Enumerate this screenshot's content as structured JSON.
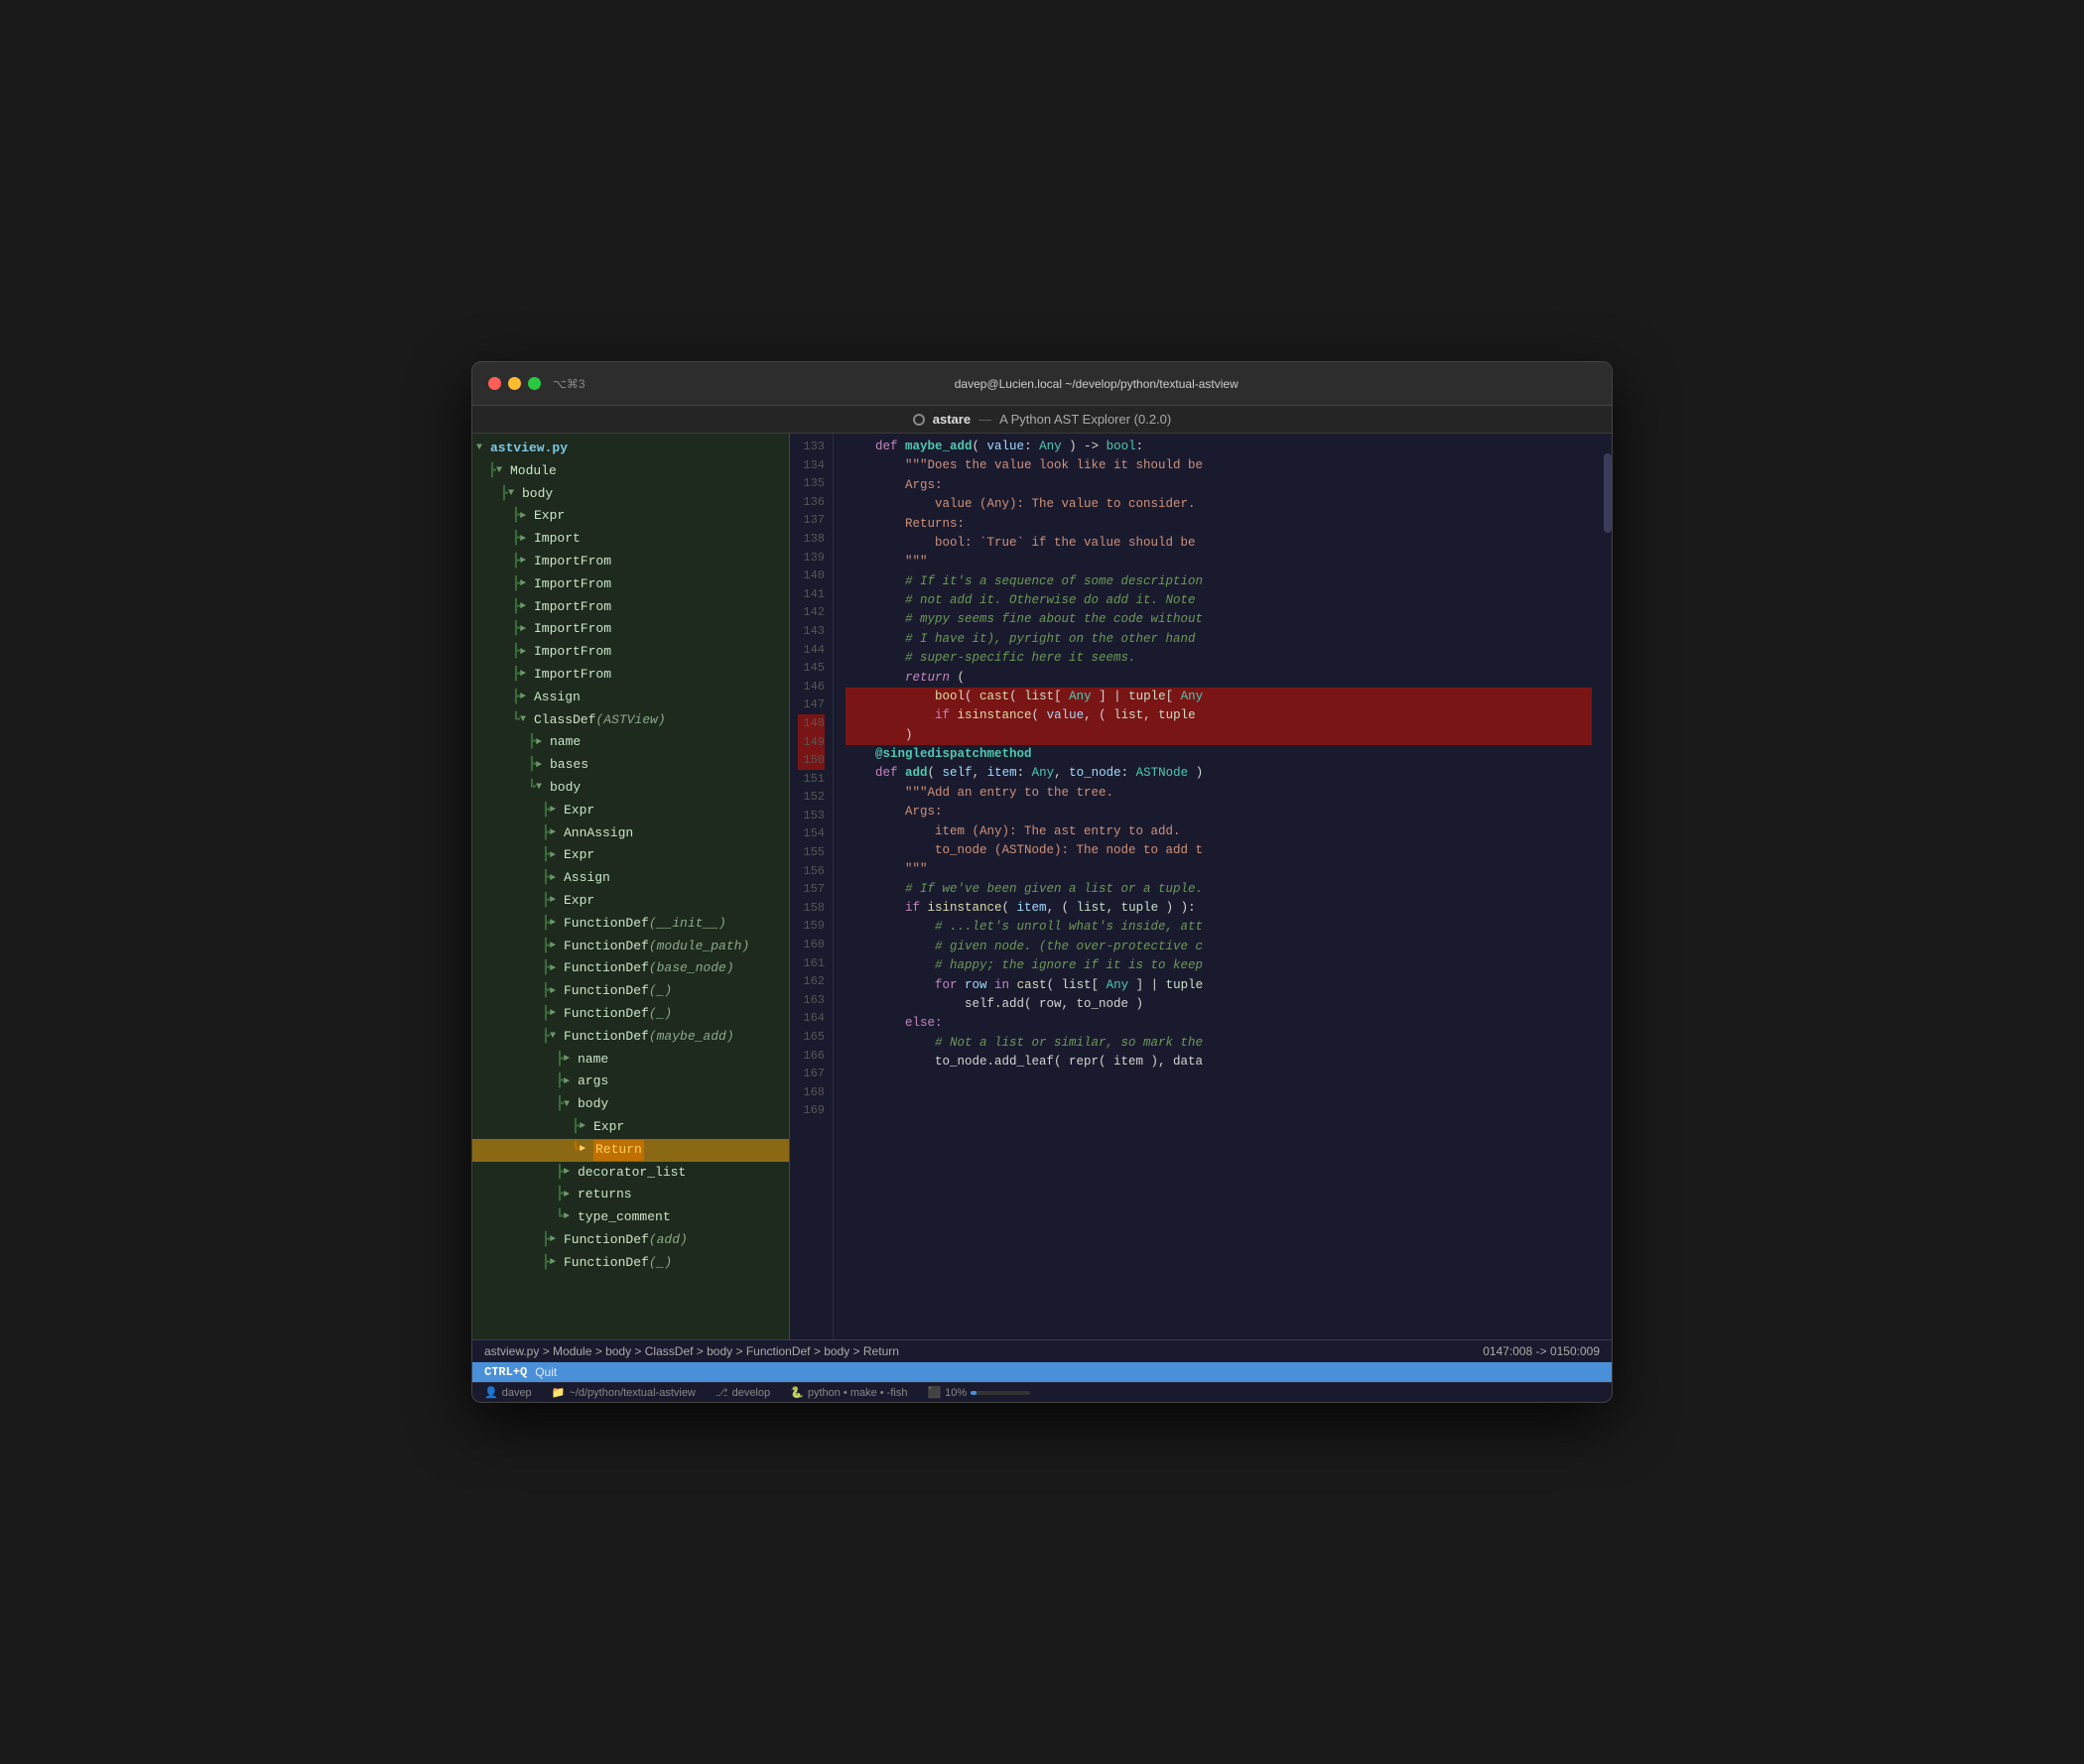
{
  "window": {
    "title": "davep@Lucien.local ~/develop/python/textual-astview",
    "kbd_hint": "⌥⌘3"
  },
  "appbar": {
    "app_name": "astare",
    "tagline": "A Python AST Explorer (0.2.0)"
  },
  "tree": {
    "file": "astview.py",
    "items": [
      {
        "indent": 0,
        "arrow": "▼",
        "label": "astview.py",
        "type": "file"
      },
      {
        "indent": 1,
        "arrow": "▼",
        "label": "Module",
        "type": "module"
      },
      {
        "indent": 2,
        "arrow": "▼",
        "label": "body",
        "type": "body"
      },
      {
        "indent": 3,
        "arrow": "►",
        "label": "Expr",
        "type": "node"
      },
      {
        "indent": 3,
        "arrow": "►",
        "label": "Import",
        "type": "node"
      },
      {
        "indent": 3,
        "arrow": "►",
        "label": "ImportFrom",
        "type": "node"
      },
      {
        "indent": 3,
        "arrow": "►",
        "label": "ImportFrom",
        "type": "node"
      },
      {
        "indent": 3,
        "arrow": "►",
        "label": "ImportFrom",
        "type": "node"
      },
      {
        "indent": 3,
        "arrow": "►",
        "label": "ImportFrom",
        "type": "node"
      },
      {
        "indent": 3,
        "arrow": "►",
        "label": "ImportFrom",
        "type": "node"
      },
      {
        "indent": 3,
        "arrow": "►",
        "label": "ImportFrom",
        "type": "node"
      },
      {
        "indent": 3,
        "arrow": "►",
        "label": "Assign",
        "type": "node"
      },
      {
        "indent": 3,
        "arrow": "▼",
        "label": "ClassDef",
        "suffix": "(ASTView)",
        "type": "classdef"
      },
      {
        "indent": 4,
        "arrow": "►",
        "label": "name",
        "type": "node"
      },
      {
        "indent": 4,
        "arrow": "►",
        "label": "bases",
        "type": "node"
      },
      {
        "indent": 4,
        "arrow": "▼",
        "label": "body",
        "type": "body"
      },
      {
        "indent": 5,
        "arrow": "►",
        "label": "Expr",
        "type": "node"
      },
      {
        "indent": 5,
        "arrow": "►",
        "label": "AnnAssign",
        "type": "node"
      },
      {
        "indent": 5,
        "arrow": "►",
        "label": "Expr",
        "type": "node"
      },
      {
        "indent": 5,
        "arrow": "►",
        "label": "Assign",
        "type": "node"
      },
      {
        "indent": 5,
        "arrow": "►",
        "label": "Expr",
        "type": "node"
      },
      {
        "indent": 5,
        "arrow": "►",
        "label": "FunctionDef",
        "suffix": "(__init__)",
        "type": "funcdef"
      },
      {
        "indent": 5,
        "arrow": "►",
        "label": "FunctionDef",
        "suffix": "(module_path)",
        "type": "funcdef"
      },
      {
        "indent": 5,
        "arrow": "►",
        "label": "FunctionDef",
        "suffix": "(base_node)",
        "type": "funcdef"
      },
      {
        "indent": 5,
        "arrow": "►",
        "label": "FunctionDef",
        "suffix": "(_)",
        "type": "funcdef"
      },
      {
        "indent": 5,
        "arrow": "►",
        "label": "FunctionDef",
        "suffix": "(_)",
        "type": "funcdef"
      },
      {
        "indent": 5,
        "arrow": "▼",
        "label": "FunctionDef",
        "suffix": "(maybe_add)",
        "type": "funcdef"
      },
      {
        "indent": 6,
        "arrow": "►",
        "label": "name",
        "type": "node"
      },
      {
        "indent": 6,
        "arrow": "►",
        "label": "args",
        "type": "node"
      },
      {
        "indent": 6,
        "arrow": "▼",
        "label": "body",
        "type": "body"
      },
      {
        "indent": 7,
        "arrow": "►",
        "label": "Expr",
        "type": "node"
      },
      {
        "indent": 7,
        "arrow": "►",
        "label": "Return",
        "type": "return",
        "highlighted": true
      },
      {
        "indent": 6,
        "arrow": "►",
        "label": "decorator_list",
        "type": "node"
      },
      {
        "indent": 6,
        "arrow": "►",
        "label": "returns",
        "type": "node"
      },
      {
        "indent": 6,
        "arrow": "►",
        "label": "type_comment",
        "type": "node"
      },
      {
        "indent": 5,
        "arrow": "►",
        "label": "FunctionDef",
        "suffix": "(add)",
        "type": "funcdef"
      },
      {
        "indent": 5,
        "arrow": "►",
        "label": "FunctionDef",
        "suffix": "(_)",
        "type": "funcdef"
      }
    ]
  },
  "code": {
    "lines": [
      {
        "num": 133,
        "content": "    def maybe_add( value: Any ) -> bool:",
        "highlight": false
      },
      {
        "num": 134,
        "content": "        \"\"\"Does the value look like it should be",
        "highlight": false
      },
      {
        "num": 135,
        "content": "",
        "highlight": false
      },
      {
        "num": 136,
        "content": "        Args:",
        "highlight": false
      },
      {
        "num": 137,
        "content": "            value (Any): The value to consider.",
        "highlight": false
      },
      {
        "num": 138,
        "content": "",
        "highlight": false
      },
      {
        "num": 139,
        "content": "        Returns:",
        "highlight": false
      },
      {
        "num": 140,
        "content": "            bool: `True` if the value should be",
        "highlight": false
      },
      {
        "num": 141,
        "content": "        \"\"\"",
        "highlight": false
      },
      {
        "num": 142,
        "content": "        # If it's a sequence of some description",
        "highlight": false
      },
      {
        "num": 143,
        "content": "        # not add it. Otherwise do add it. Note",
        "highlight": false
      },
      {
        "num": 144,
        "content": "        # mypy seems fine about the code without",
        "highlight": false
      },
      {
        "num": 145,
        "content": "        # I have it), pyright on the other hand",
        "highlight": false
      },
      {
        "num": 146,
        "content": "        # super-specific here it seems.",
        "highlight": false
      },
      {
        "num": 147,
        "content": "        return (",
        "highlight": false
      },
      {
        "num": 148,
        "content": "            bool( cast( list[ Any ] | tuple[ Any",
        "highlight": true
      },
      {
        "num": 149,
        "content": "            if isinstance( value, ( list, tuple",
        "highlight": true
      },
      {
        "num": 150,
        "content": "        )",
        "highlight": true
      },
      {
        "num": 151,
        "content": "",
        "highlight": false
      },
      {
        "num": 152,
        "content": "    @singledispatchmethod",
        "highlight": false
      },
      {
        "num": 153,
        "content": "    def add( self, item: Any, to_node: ASTNode )",
        "highlight": false
      },
      {
        "num": 154,
        "content": "        \"\"\"Add an entry to the tree.",
        "highlight": false
      },
      {
        "num": 155,
        "content": "",
        "highlight": false
      },
      {
        "num": 156,
        "content": "        Args:",
        "highlight": false
      },
      {
        "num": 157,
        "content": "            item (Any): The ast entry to add.",
        "highlight": false
      },
      {
        "num": 158,
        "content": "            to_node (ASTNode): The node to add t",
        "highlight": false
      },
      {
        "num": 159,
        "content": "        \"\"\"",
        "highlight": false
      },
      {
        "num": 160,
        "content": "        # If we've been given a list or a tuple.",
        "highlight": false
      },
      {
        "num": 161,
        "content": "        if isinstance( item, ( list, tuple ) ):",
        "highlight": false
      },
      {
        "num": 162,
        "content": "            # ...let's unroll what's inside, att",
        "highlight": false
      },
      {
        "num": 163,
        "content": "            # given node. (the over-protective c",
        "highlight": false
      },
      {
        "num": 164,
        "content": "            # happy; the ignore if it is to keep",
        "highlight": false
      },
      {
        "num": 165,
        "content": "            for row in cast( list[ Any ] | tuple",
        "highlight": false
      },
      {
        "num": 166,
        "content": "                self.add( row, to_node )",
        "highlight": false
      },
      {
        "num": 167,
        "content": "        else:",
        "highlight": false
      },
      {
        "num": 168,
        "content": "            # Not a list or similar, so mark the",
        "highlight": false
      },
      {
        "num": 169,
        "content": "            to_node.add_leaf( repr( item ), data",
        "highlight": false
      }
    ]
  },
  "breadcrumb": {
    "path": "astview.py > Module > body > ClassDef > body > FunctionDef > body > Return",
    "position": "0147:008 -> 0150:009"
  },
  "ctrl_bar": {
    "key": "CTRL+Q",
    "label": "Quit"
  },
  "status_bar": {
    "user": "davep",
    "path": "~/d/python/textual-astview",
    "branch": "develop",
    "python_info": "python • make • -fish",
    "progress": "10%"
  }
}
